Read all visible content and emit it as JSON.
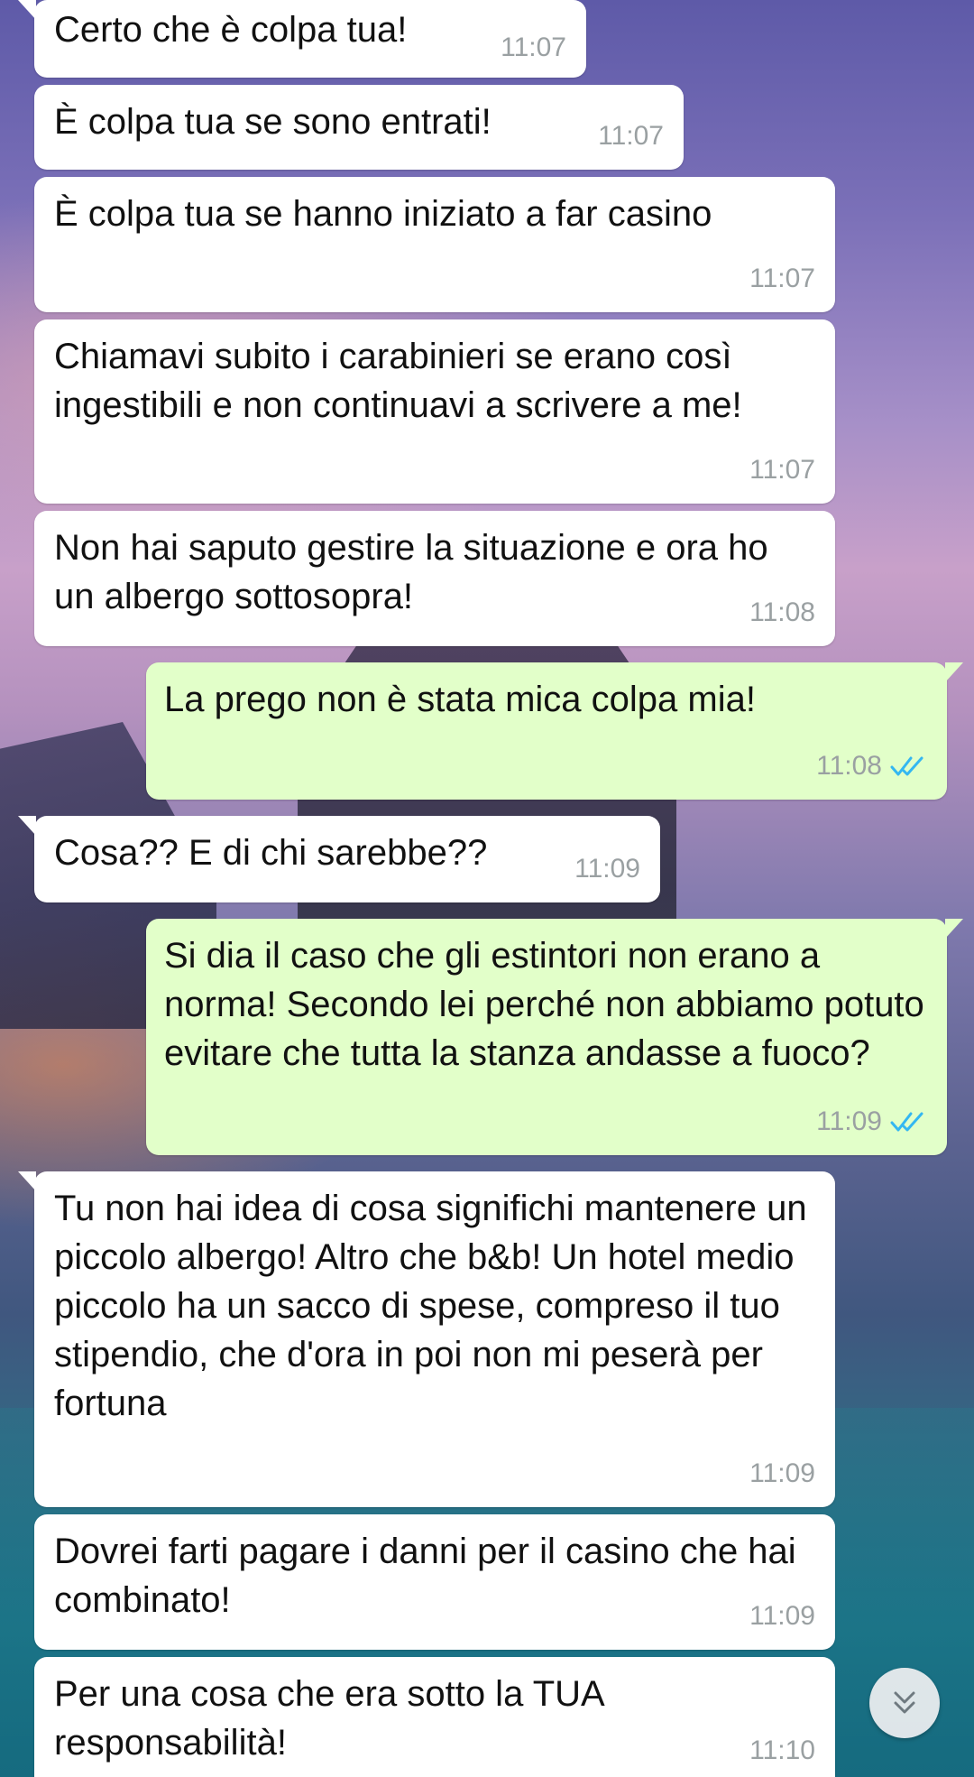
{
  "messages": [
    {
      "text": "Certo che è colpa tua!",
      "time": "11:07"
    },
    {
      "text": "È colpa tua se sono entrati!",
      "time": "11:07"
    },
    {
      "text": "È colpa tua se hanno iniziato a far casino",
      "time": "11:07"
    },
    {
      "text": "Chiamavi subito i carabinieri se erano così ingestibili e non continuavi a scrivere a me!",
      "time": "11:07"
    },
    {
      "text": "Non hai saputo gestire la situazione e ora ho un albergo sottosopra!",
      "time": "11:08"
    },
    {
      "text": "La prego non è stata mica colpa mia!",
      "time": "11:08",
      "status": "read"
    },
    {
      "text": "Cosa?? E di chi sarebbe??",
      "time": "11:09"
    },
    {
      "text": "Si dia il caso che gli estintori non erano a norma! Secondo lei perché non abbiamo potuto evitare che tutta la stanza andasse a fuoco?",
      "time": "11:09",
      "status": "read"
    },
    {
      "text": "Tu non hai idea di cosa significhi mantenere un piccolo albergo! Altro che b&b! Un hotel medio piccolo ha un sacco di spese, compreso il tuo stipendio, che d'ora in poi non mi peserà per fortuna",
      "time": "11:09"
    },
    {
      "text": "Dovrei farti pagare i danni per il casino che hai combinato!",
      "time": "11:09"
    },
    {
      "text": "Per una cosa che era sotto la TUA responsabilità!",
      "time": "11:10"
    }
  ],
  "colors": {
    "incoming_bubble": "#ffffff",
    "outgoing_bubble": "#e2ffc9",
    "timestamp": "#9aa0a2",
    "read_ticks": "#34b7f1"
  },
  "icons": {
    "read_receipt": "double-check-icon",
    "scroll_down": "double-chevron-down-icon"
  }
}
